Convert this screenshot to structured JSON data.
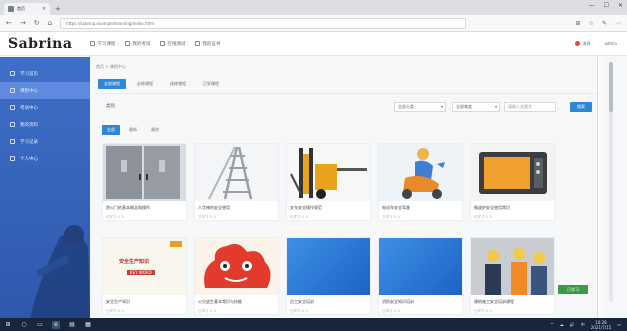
{
  "browser": {
    "tab_title": "首页",
    "tab_close": "×",
    "new_tab": "+",
    "url": "https://sabrina.example/learning/index.html",
    "nav_back": "←",
    "nav_forward": "→",
    "nav_refresh": "↻",
    "nav_home": "⌂",
    "tools": [
      "⊞",
      "☆",
      "✎",
      "⋯"
    ],
    "window_controls": [
      "—",
      "☐",
      "✕"
    ]
  },
  "app": {
    "logo": "Sabrina",
    "menu": [
      "学习课程",
      "我的考试",
      "在线测试",
      "我的证书"
    ],
    "header_right": [
      "消息",
      "admin"
    ]
  },
  "sidebar": {
    "items": [
      {
        "label": "学习首页",
        "active": false
      },
      {
        "label": "课程中心",
        "active": true
      },
      {
        "label": "考试中心",
        "active": false
      },
      {
        "label": "我的资料",
        "active": false
      },
      {
        "label": "学习记录",
        "active": false
      },
      {
        "label": "个人中心",
        "active": false
      }
    ]
  },
  "main": {
    "breadcrumb": "首页 > 课程中心",
    "top_tabs": [
      {
        "label": "全部课程",
        "active": true
      },
      {
        "label": "必修课程",
        "active": false
      },
      {
        "label": "选修课程",
        "active": false
      },
      {
        "label": "已学课程",
        "active": false
      }
    ],
    "filter": {
      "label": "类别",
      "select1": "全部分类",
      "select2": "全部难度",
      "search_placeholder": "请输入关键字",
      "search_button": "搜索"
    },
    "sub_tabs": [
      {
        "label": "全部",
        "active": true
      },
      {
        "label": "最新",
        "active": false
      },
      {
        "label": "最热",
        "active": false
      }
    ],
    "cards": [
      {
        "title": "防火门的基本概念和操作",
        "meta": "已学习 0 人",
        "thumb": "doors"
      },
      {
        "title": "人字梯的安全使用",
        "meta": "已学习 0 人",
        "thumb": "ladder"
      },
      {
        "title": "叉车安全操作规范",
        "meta": "已学习 0 人",
        "thumb": "forklift"
      },
      {
        "title": "电动车安全驾驶",
        "meta": "已学习 0 人",
        "thumb": "scooter"
      },
      {
        "title": "微波炉安全使用常识",
        "meta": "已学习 0 人",
        "thumb": "microwave"
      },
      {
        "title": "安全生产知识",
        "meta": "已学习 0 人",
        "thumb": "poster",
        "poster_title": "安全生产知识",
        "poster_sub": "KEY WORD"
      },
      {
        "title": "火灾逃生基本常识与技能",
        "meta": "已学习 0 人",
        "thumb": "cartoon"
      },
      {
        "title": "员工安全培训",
        "meta": "已学习 0 人",
        "thumb": "blue"
      },
      {
        "title": "消防安全知识培训",
        "meta": "已学习 0 人",
        "thumb": "blue"
      },
      {
        "title": "建筑施工安全培训课程",
        "meta": "已学习 0 人",
        "thumb": "workers"
      }
    ],
    "badge": "已学习"
  },
  "taskbar": {
    "start": "⊞",
    "apps": [
      "○",
      "▭",
      "e",
      "▤",
      "▦"
    ],
    "tray": [
      "^",
      "☁",
      "🔊",
      "中"
    ],
    "time": "10:28",
    "date": "2021/7/15",
    "notify": "▭"
  },
  "colors": {
    "accent": "#2d86d6",
    "sidebar": "#3f6fc8",
    "sidebar_active": "#5f8ae0",
    "taskbar": "#17263a"
  }
}
